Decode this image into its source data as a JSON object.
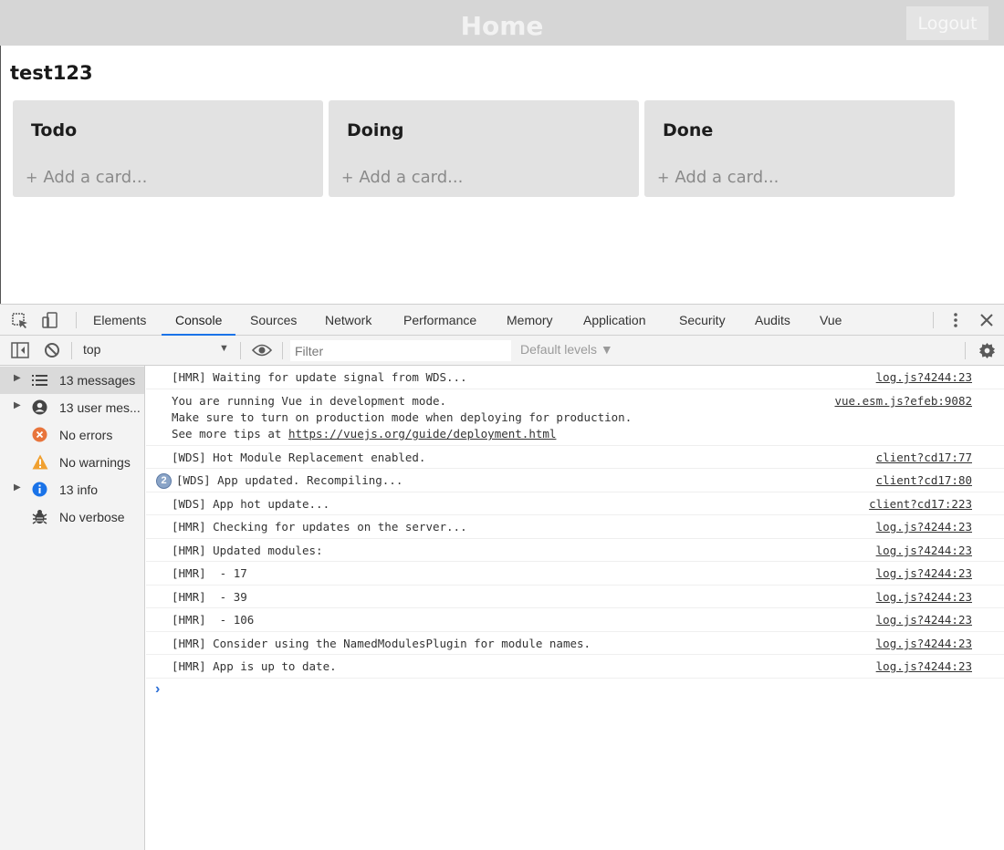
{
  "app": {
    "title": "Home",
    "logout_label": "Logout",
    "board_title": "test123",
    "lists": [
      {
        "title": "Todo",
        "add_card": "Add a card..."
      },
      {
        "title": "Doing",
        "add_card": "Add a card..."
      },
      {
        "title": "Done",
        "add_card": "Add a card..."
      }
    ],
    "add_card_icon": "+"
  },
  "devtools": {
    "tabs": [
      "Elements",
      "Console",
      "Sources",
      "Network",
      "Performance",
      "Memory",
      "Application",
      "Security",
      "Audits",
      "Vue"
    ],
    "active_tab": "Console",
    "context": "top",
    "filter_placeholder": "Filter",
    "default_levels": "Default levels ▼",
    "sidebar": [
      {
        "label": "13 messages",
        "icon": "list-icon",
        "expandable": true,
        "selected": true
      },
      {
        "label": "13 user mes...",
        "icon": "user-icon",
        "expandable": true,
        "selected": false
      },
      {
        "label": "No errors",
        "icon": "error-icon",
        "expandable": false,
        "selected": false
      },
      {
        "label": "No warnings",
        "icon": "warning-icon",
        "expandable": false,
        "selected": false
      },
      {
        "label": "13 info",
        "icon": "info-icon",
        "expandable": true,
        "selected": false
      },
      {
        "label": "No verbose",
        "icon": "bug-icon",
        "expandable": false,
        "selected": false
      }
    ],
    "messages": [
      {
        "text": "[HMR] Waiting for update signal from WDS...",
        "source": "log.js?4244:23"
      },
      {
        "text": "You are running Vue in development mode.\nMake sure to turn on production mode when deploying for production.\nSee more tips at ",
        "link": "https://vuejs.org/guide/deployment.html",
        "source": "vue.esm.js?efeb:9082"
      },
      {
        "text": "[WDS] Hot Module Replacement enabled.",
        "source": "client?cd17:77"
      },
      {
        "text": "[WDS] App updated. Recompiling...",
        "source": "client?cd17:80",
        "repeat": "2"
      },
      {
        "text": "[WDS] App hot update...",
        "source": "client?cd17:223"
      },
      {
        "text": "[HMR] Checking for updates on the server...",
        "source": "log.js?4244:23"
      },
      {
        "text": "[HMR] Updated modules:",
        "source": "log.js?4244:23"
      },
      {
        "text": "[HMR]  - 17",
        "source": "log.js?4244:23"
      },
      {
        "text": "[HMR]  - 39",
        "source": "log.js?4244:23"
      },
      {
        "text": "[HMR]  - 106",
        "source": "log.js?4244:23"
      },
      {
        "text": "[HMR] Consider using the NamedModulesPlugin for module names.",
        "source": "log.js?4244:23"
      },
      {
        "text": "[HMR] App is up to date.",
        "source": "log.js?4244:23"
      }
    ],
    "prompt_symbol": "›",
    "colors": {
      "accent": "#1a73e8",
      "error": "#e8743b",
      "warning": "#f0a030",
      "info": "#1a73e8"
    }
  }
}
